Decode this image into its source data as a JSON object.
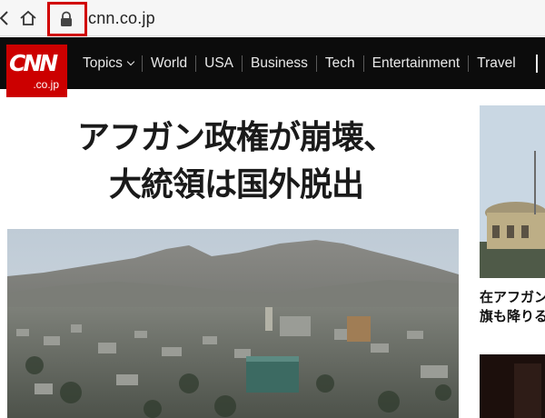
{
  "browser": {
    "url": "cnn.co.jp",
    "icons": {
      "back": "chevron-left-icon",
      "home": "home-icon",
      "lock": "lock-icon"
    },
    "highlight_color": "#d10000"
  },
  "site": {
    "logo_text": "CNN",
    "logo_sub": ".co.jp",
    "brand_color": "#cc0000",
    "nav": [
      {
        "label": "Topics",
        "has_dropdown": true
      },
      {
        "label": "World"
      },
      {
        "label": "USA"
      },
      {
        "label": "Business"
      },
      {
        "label": "Tech"
      },
      {
        "label": "Entertainment"
      },
      {
        "label": "Travel"
      }
    ]
  },
  "main": {
    "headline_line1": "アフガン政権が崩壊、",
    "headline_line2": "大統領は国外脱出"
  },
  "sidebar": {
    "story_line1": "在アフガン",
    "story_line2": "旗も降りる"
  }
}
